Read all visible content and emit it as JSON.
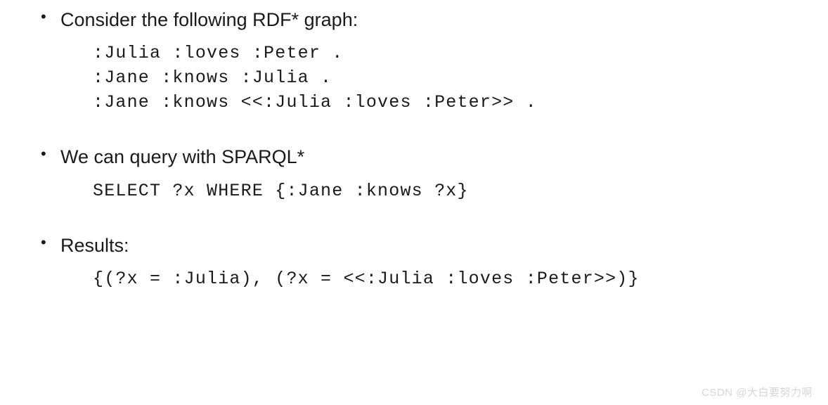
{
  "sections": [
    {
      "heading": "Consider the following RDF* graph:",
      "code": ":Julia :loves :Peter .\n:Jane :knows :Julia .\n:Jane :knows <<:Julia :loves :Peter>> ."
    },
    {
      "heading": "We can query with SPARQL*",
      "code": "SELECT ?x WHERE {:Jane :knows ?x}"
    },
    {
      "heading": "Results:",
      "code": "{(?x = :Julia), (?x = <<:Julia :loves :Peter>>)}"
    }
  ],
  "bullet_glyph": "•",
  "watermark": "CSDN @大白要努力啊"
}
